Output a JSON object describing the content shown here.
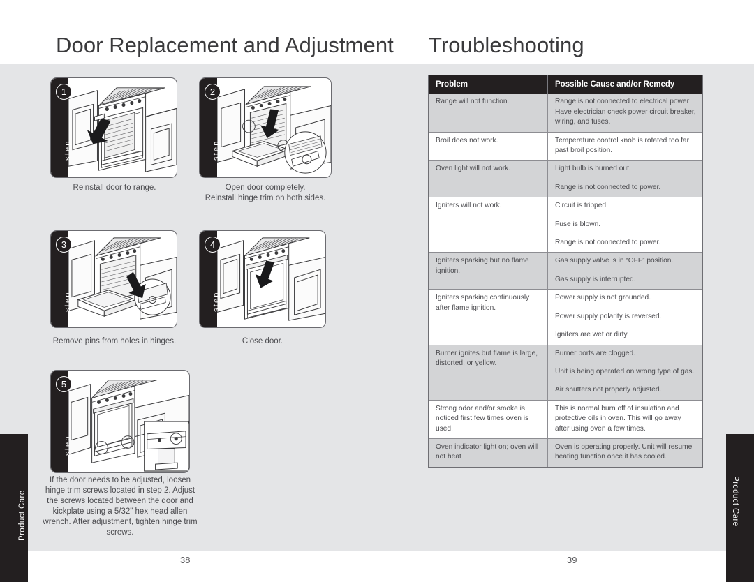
{
  "left_page": {
    "title": "Door Replacement and Adjustment",
    "folio": "38",
    "thumb_tab": "Product Care",
    "step_word": "step",
    "steps": [
      {
        "number": "1",
        "caption": "Reinstall door to range.",
        "figure": "range-door-reinstall-illustration"
      },
      {
        "number": "2",
        "caption": "Open door completely.\nReinstall hinge trim on both sides.",
        "figure": "range-door-open-hinge-trim-illustration"
      },
      {
        "number": "3",
        "caption": "Remove pins from holes in hinges.",
        "figure": "range-hinge-pins-illustration"
      },
      {
        "number": "4",
        "caption": "Close door.",
        "figure": "range-door-close-illustration"
      },
      {
        "number": "5",
        "caption": "If the door needs to be adjusted, loosen hinge trim screws located in step 2. Adjust the screws located between the door and kickplate using a 5/32\" hex head allen wrench. After adjustment, tighten hinge trim screws.",
        "figure": "range-door-adjustment-illustration"
      }
    ]
  },
  "right_page": {
    "title": "Troubleshooting",
    "folio": "39",
    "thumb_tab": "Product Care",
    "table": {
      "headers": [
        "Problem",
        "Possible Cause and/or Remedy"
      ],
      "rows": [
        {
          "problem": "Range will not function.",
          "remedies": [
            "Range is not connected to electrical power: Have electrician check power circuit breaker, wiring, and fuses."
          ]
        },
        {
          "problem": "Broil does not work.",
          "remedies": [
            "Temperature control knob is rotated too far past broil position."
          ]
        },
        {
          "problem": "Oven light will not work.",
          "remedies": [
            "Light bulb is burned out.",
            "Range is not connected to power."
          ]
        },
        {
          "problem": "Igniters will not work.",
          "remedies": [
            "Circuit is tripped.",
            "Fuse is blown.",
            "Range is not connected to power."
          ]
        },
        {
          "problem": "Igniters sparking but no flame ignition.",
          "remedies": [
            "Gas supply valve is in “OFF” position.",
            "Gas supply is interrupted."
          ]
        },
        {
          "problem": "Igniters sparking continuously after flame ignition.",
          "remedies": [
            "Power supply is not grounded.",
            "Power supply polarity is reversed.",
            "Igniters are wet or dirty."
          ]
        },
        {
          "problem": "Burner ignites but flame is large, distorted, or yellow.",
          "remedies": [
            "Burner ports are clogged.",
            "Unit is being operated on wrong type of gas.",
            "Air shutters not properly adjusted."
          ]
        },
        {
          "problem": "Strong odor and/or smoke is noticed first few times oven is used.",
          "remedies": [
            "This is normal burn off of insulation and protective oils in oven. This will go away after using oven a few times."
          ]
        },
        {
          "problem": "Oven indicator light on; oven will not heat",
          "remedies": [
            "Oven is operating properly. Unit will resume heating function once it has cooled."
          ]
        }
      ]
    }
  },
  "colors": {
    "page_background": "#e4e5e7",
    "ink": "#231f20",
    "table_shade": "#d3d4d6",
    "text": "#4b4b4f"
  }
}
